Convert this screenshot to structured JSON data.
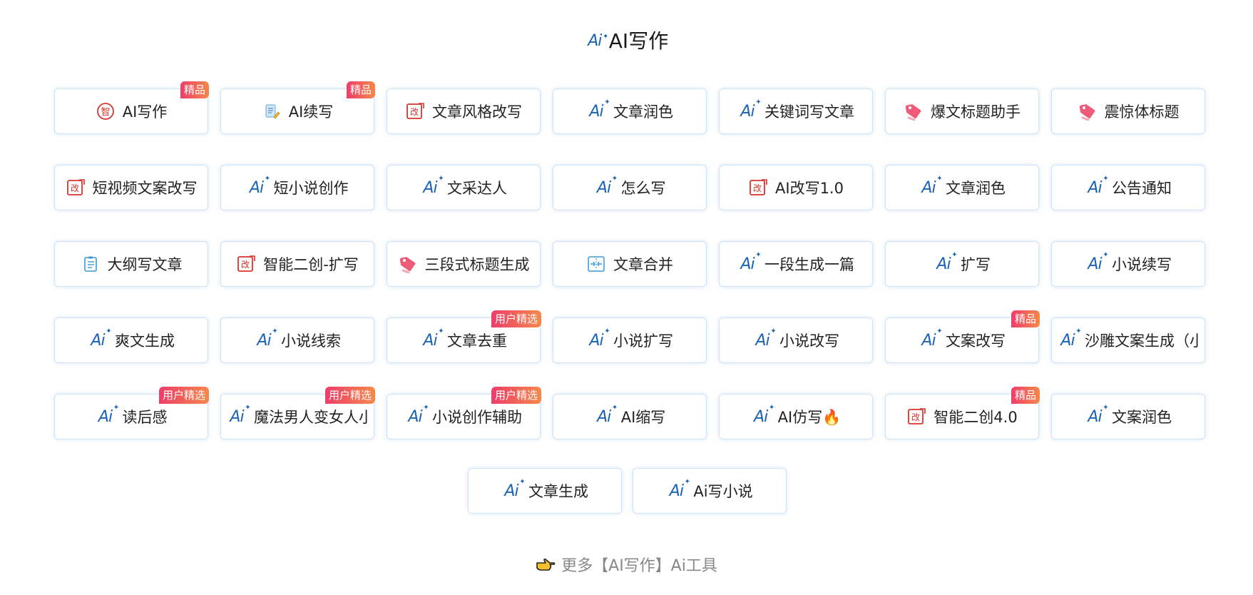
{
  "section": {
    "icon": "ai-sparkle-icon",
    "title": "AI写作"
  },
  "badges": {
    "premium": "精品",
    "user_pick": "用户精选"
  },
  "icon_text": {
    "ai": "Ai",
    "zhi": "智",
    "gai": "改"
  },
  "tools": [
    {
      "label": "AI写作",
      "icon": "zhi-circle-icon",
      "badge": "精品"
    },
    {
      "label": "AI续写",
      "icon": "notepad-pencil-icon",
      "badge": "精品"
    },
    {
      "label": "文章风格改写",
      "icon": "gai-rewrite-icon"
    },
    {
      "label": "文章润色",
      "icon": "ai-sparkle-icon"
    },
    {
      "label": "关键词写文章",
      "icon": "ai-sparkle-icon"
    },
    {
      "label": "爆文标题助手",
      "icon": "tag-icon"
    },
    {
      "label": "震惊体标题",
      "icon": "tag-icon"
    },
    {
      "label": "短视频文案改写",
      "icon": "gai-rewrite-icon"
    },
    {
      "label": "短小说创作",
      "icon": "ai-sparkle-icon"
    },
    {
      "label": "文采达人",
      "icon": "ai-sparkle-icon"
    },
    {
      "label": "怎么写",
      "icon": "ai-sparkle-icon"
    },
    {
      "label": "AI改写1.0",
      "icon": "gai-rewrite-icon"
    },
    {
      "label": "文章润色",
      "icon": "ai-sparkle-icon"
    },
    {
      "label": "公告通知",
      "icon": "ai-sparkle-icon"
    },
    {
      "label": "大纲写文章",
      "icon": "outline-list-icon"
    },
    {
      "label": "智能二创-扩写",
      "icon": "gai-rewrite-icon"
    },
    {
      "label": "三段式标题生成",
      "icon": "tag-icon"
    },
    {
      "label": "文章合并",
      "icon": "merge-icon"
    },
    {
      "label": "一段生成一篇",
      "icon": "ai-sparkle-icon"
    },
    {
      "label": "扩写",
      "icon": "ai-sparkle-icon"
    },
    {
      "label": "小说续写",
      "icon": "ai-sparkle-icon"
    },
    {
      "label": "爽文生成",
      "icon": "ai-sparkle-icon"
    },
    {
      "label": "小说线索",
      "icon": "ai-sparkle-icon"
    },
    {
      "label": "文章去重",
      "icon": "ai-sparkle-icon",
      "badge": "用户精选"
    },
    {
      "label": "小说扩写",
      "icon": "ai-sparkle-icon"
    },
    {
      "label": "小说改写",
      "icon": "ai-sparkle-icon"
    },
    {
      "label": "文案改写",
      "icon": "ai-sparkle-icon",
      "badge": "精品"
    },
    {
      "label": "沙雕文案生成（小",
      "icon": "ai-sparkle-icon"
    },
    {
      "label": "读后感",
      "icon": "ai-sparkle-icon",
      "badge": "用户精选"
    },
    {
      "label": "魔法男人变女人小",
      "icon": "ai-sparkle-icon",
      "badge": "用户精选"
    },
    {
      "label": "小说创作辅助",
      "icon": "ai-sparkle-icon",
      "badge": "用户精选"
    },
    {
      "label": "AI缩写",
      "icon": "ai-sparkle-icon"
    },
    {
      "label": "AI仿写🔥",
      "icon": "ai-sparkle-icon"
    },
    {
      "label": "智能二创4.0",
      "icon": "gai-rewrite-icon",
      "badge": "精品"
    },
    {
      "label": "文案润色",
      "icon": "ai-sparkle-icon"
    }
  ],
  "tools_last_row": [
    {
      "label": "文章生成",
      "icon": "ai-sparkle-icon"
    },
    {
      "label": "Ai写小说",
      "icon": "ai-sparkle-icon"
    }
  ],
  "more_link": {
    "icon": "pointing-hand-icon",
    "label": "更多【AI写作】Ai工具"
  },
  "colors": {
    "ai_blue": "#1b63b4",
    "gai_red": "#d9342b",
    "tag_pink": "#ef5a78",
    "outline_blue": "#3a9ad9",
    "badge_start": "#ee3d6a",
    "badge_end": "#f4894a",
    "card_border": "#cfe3f7"
  }
}
